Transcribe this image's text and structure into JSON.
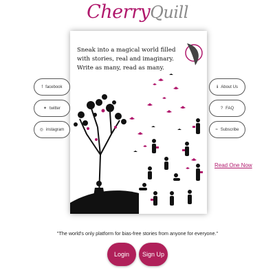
{
  "brand": {
    "part1": "Cherry",
    "part2": "Quill"
  },
  "hero": {
    "line1": "Sneak into a magical world filled with stories, real and imaginary.",
    "line2": "Write as many, read as many."
  },
  "social": {
    "facebook": {
      "label": "facebook",
      "icon": "facebook-icon"
    },
    "twitter": {
      "label": "twitter",
      "icon": "twitter-icon"
    },
    "instagram": {
      "label": "instagram",
      "icon": "instagram-icon"
    }
  },
  "nav": {
    "about": {
      "label": "About Us",
      "icon": "info-icon"
    },
    "faq": {
      "label": "FAQ",
      "icon": "question-icon"
    },
    "subscribe": {
      "label": "Subscribe",
      "icon": "rss-icon"
    }
  },
  "read_link": "Read One Now",
  "quote": "\"The world's only platform for bias-free stories from anyone for everyone.\"",
  "buttons": {
    "login": "Login",
    "signup": "Sign Up"
  },
  "colors": {
    "accent": "#b0186c",
    "button": "#b0205a"
  }
}
